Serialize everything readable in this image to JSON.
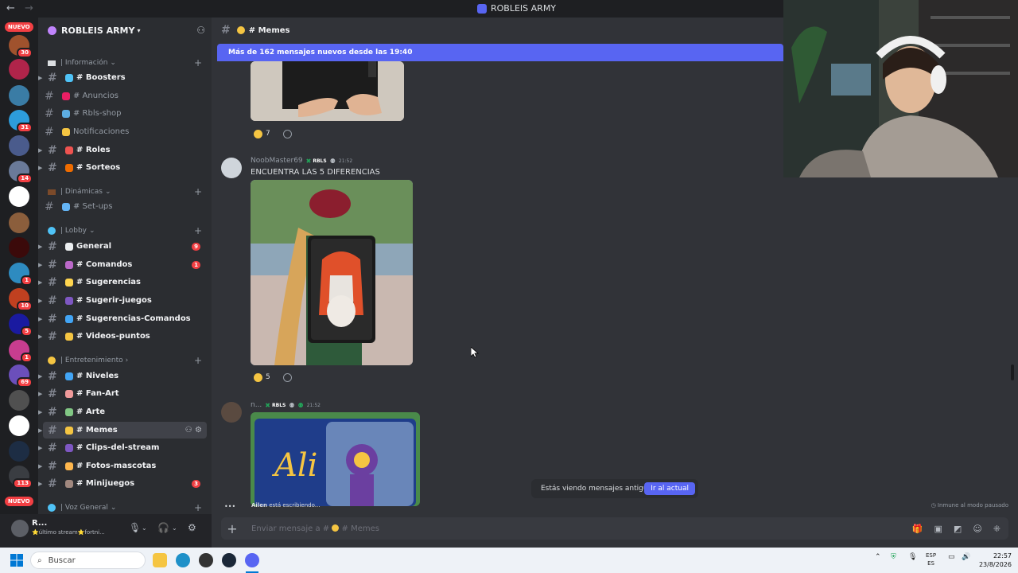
{
  "titlebar": {
    "back": "←",
    "forward": "→",
    "title": "ROBLEIS ARMY"
  },
  "rail": {
    "nuevo_top": "NUEVO",
    "nuevo_bottom": "NUEVO",
    "badges": [
      "30",
      "31",
      "14",
      "1",
      "10",
      "5",
      "1",
      "69",
      "1",
      "113"
    ]
  },
  "guild": {
    "name": "ROBLEIS ARMY"
  },
  "categories": {
    "informacion": "| Información",
    "dinamicas": "| Dinámicas",
    "lobby": "| Lobby",
    "entretenimiento": "| Entretenimiento",
    "voz": "| Voz General"
  },
  "channels": {
    "boosters": "# Boosters",
    "anuncios": "# Anuncios",
    "rbls_shop": "# Rbls-shop",
    "notificaciones": "Notificaciones",
    "roles": "# Roles",
    "sorteos": "# Sorteos",
    "setups": "# Set-ups",
    "general": "General",
    "general_count": "9",
    "comandos": "# Comandos",
    "comandos_count": "1",
    "sugerencias": "# Sugerencias",
    "sugerir_juegos": "# Sugerir-juegos",
    "sugerencias_comandos": "# Sugerencias-Comandos",
    "videos_puntos": "# Videos-puntos",
    "niveles": "# Niveles",
    "fan_art": "# Fan-Art",
    "arte": "# Arte",
    "memes": "# Memes",
    "clips": "# Clips-del-stream",
    "fotos": "# Fotos-mascotas",
    "minijuegos": "# Minijuegos",
    "minijuegos_count": "3"
  },
  "user": {
    "name": "R...",
    "status": "⭐último stream⭐fortni..."
  },
  "chat": {
    "header": "# Memes",
    "new_banner": "Más de 162 mensajes nuevos desde las 19:40",
    "reaction1_count": "7",
    "msg2": {
      "author": "NoobMaster69",
      "tag": "RBLS",
      "time": "21:52",
      "text": "ENCUENTRA LAS 5 DIFERENCIAS",
      "reaction_count": "5"
    },
    "msg3": {
      "author": "n...",
      "tag": "RBLS",
      "time": "21:52"
    },
    "old_msgs": "Estás viendo mensajes antiguos",
    "jump": "Ir al actual",
    "typing_user": "Ailen",
    "typing_text": "está escribiendo...",
    "slowmode": "Inmune al modo pausado",
    "composer_placeholder": "Enviar mensaje a #",
    "composer_channel": "# Memes"
  },
  "taskbar": {
    "search": "Buscar",
    "lang_top": "ESP",
    "lang_bottom": "ES",
    "time": "22:57",
    "date": "23/8/2026"
  },
  "colors": {
    "accent": "#5865f2",
    "badge": "#f23f43",
    "online": "#23a55a"
  }
}
